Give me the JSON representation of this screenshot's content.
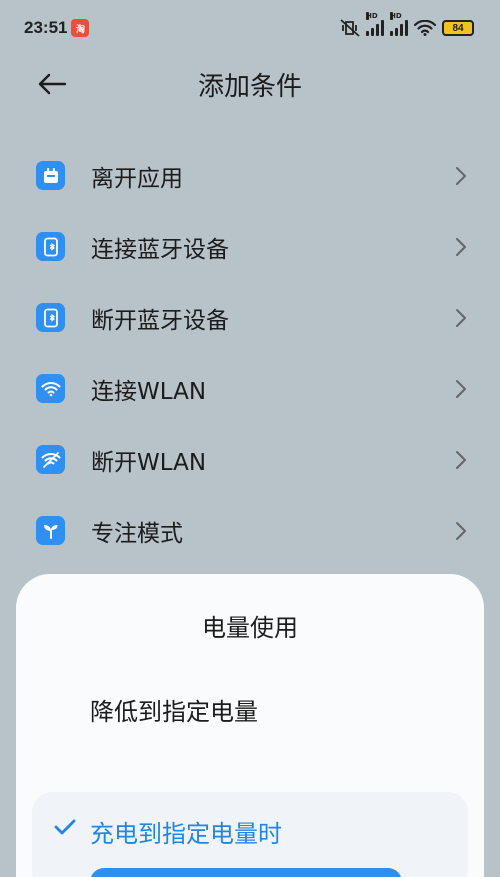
{
  "status_bar": {
    "time": "23:51",
    "notif_badge": "淘",
    "signal1_hd": "HD",
    "signal2_hd": "HD",
    "battery": "84"
  },
  "header": {
    "title": "添加条件"
  },
  "list": {
    "items": [
      {
        "label": "离开应用",
        "icon": "app-icon"
      },
      {
        "label": "连接蓝牙设备",
        "icon": "bluetooth-device-icon"
      },
      {
        "label": "断开蓝牙设备",
        "icon": "bluetooth-device-icon"
      },
      {
        "label": "连接WLAN",
        "icon": "wifi-icon"
      },
      {
        "label": "断开WLAN",
        "icon": "wifi-off-icon"
      },
      {
        "label": "专注模式",
        "icon": "sprout-icon"
      }
    ]
  },
  "sheet": {
    "title": "电量使用",
    "option1": "降低到指定电量",
    "option2": "充电到指定电量时"
  },
  "colors": {
    "accent": "#2f8ff2",
    "selected_text": "#1f86e8",
    "background": "#b7c2c9",
    "sheet": "#fafbfc"
  }
}
